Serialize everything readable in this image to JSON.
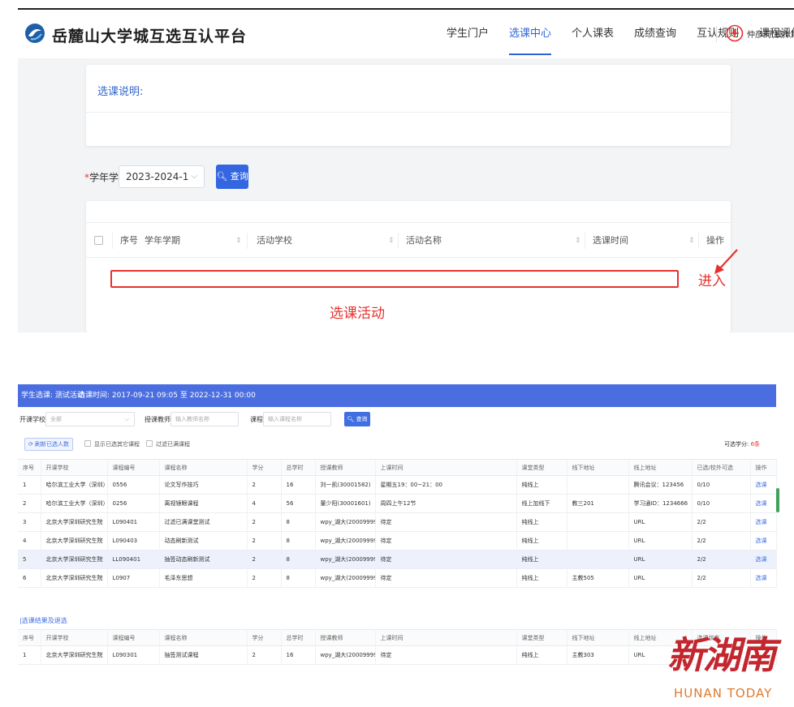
{
  "header": {
    "brand_title": "岳麓山大学城互选互认平台",
    "nav": [
      "学生门户",
      "选课中心",
      "个人课表",
      "成绩查询",
      "互认规则",
      "课程评估"
    ],
    "active_nav": "选课中心",
    "user_name": "仲彦同(模拟用户)"
  },
  "intro": {
    "title": "选课说明:"
  },
  "term_filter": {
    "label": "学年学期",
    "value": "2023-2024-1",
    "query_label": "查询"
  },
  "activity_table": {
    "columns": [
      "序号",
      "学年学期",
      "活动学校",
      "活动名称",
      "选课时间",
      "操作"
    ]
  },
  "annotations": {
    "enter": "进入",
    "activity": "选课活动"
  },
  "bottom": {
    "banner": {
      "activity": "学生选课: 测试活动",
      "time": "选课时间: 2017-09-21 09:05 至 2022-12-31 00:00"
    },
    "filters": {
      "school_label": "开课学校",
      "school_value": "全部",
      "teacher_label": "授课教师",
      "teacher_placeholder": "输入教师名称",
      "course_label": "课程",
      "course_placeholder": "输入课程名称",
      "query_label": "查询"
    },
    "actions": {
      "refresh": "刷新已选人数",
      "show_other": "显示已选其它课程",
      "filter_full": "过滤已满课程",
      "credit_label": "可选学分:",
      "credit_value": "6条"
    },
    "columns": [
      "序号",
      "开课学校",
      "课程编号",
      "课程名称",
      "学分",
      "总学时",
      "授课教师",
      "上课时间",
      "课堂类型",
      "线下地址",
      "线上地址",
      "已选/校外可选",
      "操作"
    ],
    "rows": [
      [
        "1",
        "哈尔滨工业大学（深圳）",
        "0556",
        "论文写作技巧",
        "2",
        "16",
        "刘一凯(30001582)",
        "星期五19：00~21：00",
        "纯线上",
        "",
        "腾讯会议：123456",
        "0/10",
        "选课"
      ],
      [
        "2",
        "哈尔滨工业大学（深圳）",
        "0256",
        "离视镜眼课程",
        "4",
        "56",
        "董少阳(30001601)",
        "周四上午12节",
        "线上加线下",
        "教三201",
        "学习通ID：1234666",
        "0/10",
        "选课"
      ],
      [
        "3",
        "北京大学深圳研究生院",
        "L090401",
        "过滤已满课堂测试",
        "2",
        "8",
        "wpy_湖大(20009999)",
        "待定",
        "纯线上",
        "",
        "URL",
        "2/2",
        "选课"
      ],
      [
        "4",
        "北京大学深圳研究生院",
        "L090403",
        "动态刷新测试",
        "2",
        "8",
        "wpy_湖大(20009999)",
        "待定",
        "纯线上",
        "",
        "URL",
        "2/2",
        "选课"
      ],
      [
        "5",
        "北京大学深圳研究生院",
        "LL090401",
        "抽签动态刷新测试",
        "2",
        "8",
        "wpy_湖大(20009999)",
        "待定",
        "纯线上",
        "",
        "URL",
        "2/2",
        "选课"
      ],
      [
        "6",
        "北京大学深圳研究生院",
        "L0907",
        "毛泽东思想",
        "2",
        "8",
        "wpy_湖大(20009999)",
        "待定",
        "纯线上",
        "主教505",
        "URL",
        "2/2",
        "选课"
      ]
    ],
    "highlight_row": 4,
    "result_title": "|选课结果及退选",
    "result_columns": [
      "序号",
      "开课学校",
      "课程编号",
      "课程名称",
      "学分",
      "总学时",
      "授课教师",
      "上课时间",
      "课堂类型",
      "线下地址",
      "线上地址",
      "选课状态",
      "操作"
    ],
    "result_rows": [
      [
        "1",
        "北京大学深圳研究生院",
        "L090301",
        "抽签测试课程",
        "2",
        "16",
        "wpy_湖大(20009999)",
        "待定",
        "纯线上",
        "主教303",
        "URL",
        "",
        ""
      ]
    ]
  },
  "watermark": {
    "cn": "新湖南",
    "en": "HUNAN TODAY"
  },
  "colors": {
    "primary": "#3366e0",
    "banner": "#4a6ee0",
    "annotation": "#e5322d",
    "watermark_red": "#c4262e",
    "watermark_orange": "#e07a2e"
  }
}
